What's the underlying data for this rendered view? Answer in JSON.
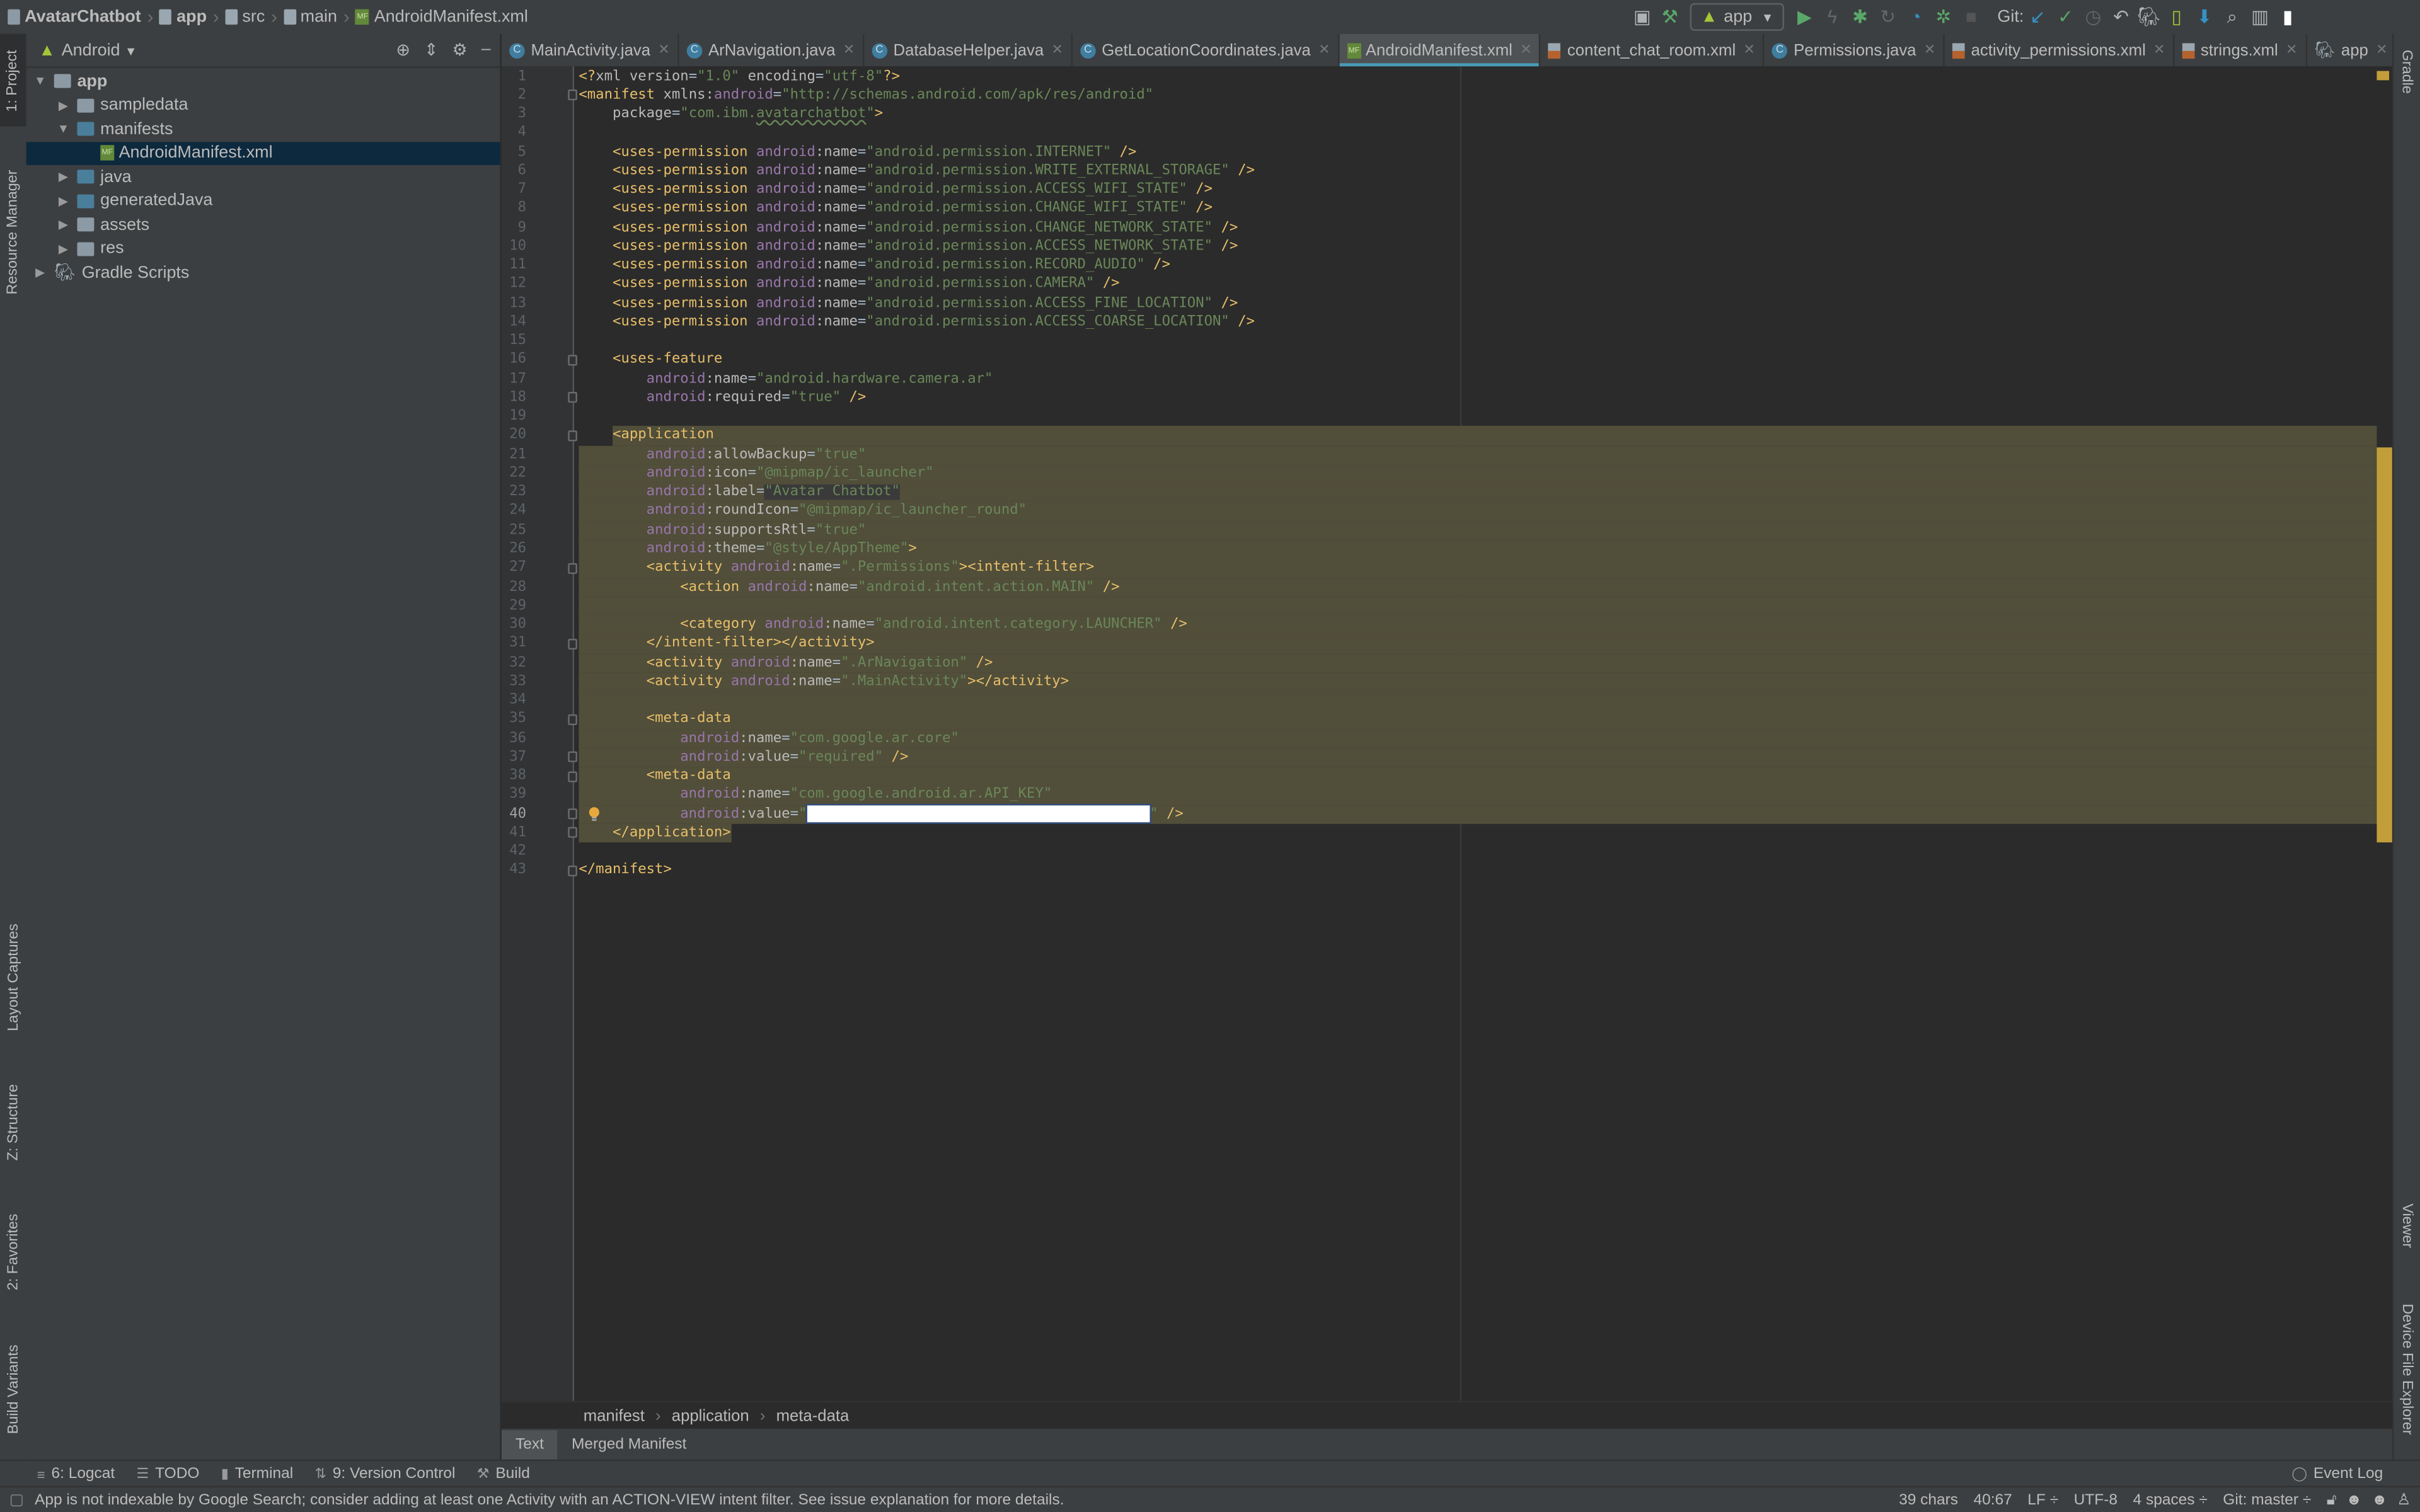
{
  "breadcrumb": [
    "AvatarChatbot",
    "app",
    "src",
    "main",
    "AndroidManifest.xml"
  ],
  "toolbar": {
    "run_config": "app",
    "git_label": "Git:",
    "icons": [
      "terminal-icon",
      "hammer-icon",
      "run-icon",
      "apply-changes-icon",
      "debug-icon",
      "attach-debugger-icon",
      "profile-icon",
      "coverage-icon",
      "stop-icon",
      "git-update-icon",
      "git-commit-icon",
      "git-history-icon",
      "git-rollback-icon",
      "gradle-sync-icon",
      "avd-manager-icon",
      "sdk-manager-icon",
      "search-icon",
      "project-structure-icon",
      "user-icon"
    ]
  },
  "left_strip": [
    "1: Project",
    "Resource Manager",
    "Layout Captures",
    "Z: Structure",
    "2: Favorites",
    "Build Variants"
  ],
  "right_strip": [
    "Gradle",
    "Viewer",
    "Device File Explorer"
  ],
  "project_panel": {
    "view": "Android",
    "tree": [
      {
        "label": "app",
        "depth": 0,
        "expanded": true,
        "icon": "module-folder"
      },
      {
        "label": "sampledata",
        "depth": 1,
        "expanded": false,
        "icon": "folder"
      },
      {
        "label": "manifests",
        "depth": 1,
        "expanded": true,
        "icon": "source-folder"
      },
      {
        "label": "AndroidManifest.xml",
        "depth": 2,
        "icon": "manifest-file",
        "selected": true
      },
      {
        "label": "java",
        "depth": 1,
        "expanded": false,
        "icon": "source-folder"
      },
      {
        "label": "generatedJava",
        "depth": 1,
        "expanded": false,
        "icon": "generated-folder"
      },
      {
        "label": "assets",
        "depth": 1,
        "expanded": false,
        "icon": "resource-folder"
      },
      {
        "label": "res",
        "depth": 1,
        "expanded": false,
        "icon": "resource-folder"
      },
      {
        "label": "Gradle Scripts",
        "depth": 0,
        "expanded": false,
        "icon": "gradle"
      }
    ]
  },
  "tabs": [
    {
      "label": "MainActivity.java",
      "icon": "java-class"
    },
    {
      "label": "ArNavigation.java",
      "icon": "java-class"
    },
    {
      "label": "DatabaseHelper.java",
      "icon": "java-class"
    },
    {
      "label": "GetLocationCoordinates.java",
      "icon": "java-class"
    },
    {
      "label": "AndroidManifest.xml",
      "icon": "manifest",
      "active": true
    },
    {
      "label": "content_chat_room.xml",
      "icon": "xml"
    },
    {
      "label": "Permissions.java",
      "icon": "java-class"
    },
    {
      "label": "activity_permissions.xml",
      "icon": "xml"
    },
    {
      "label": "strings.xml",
      "icon": "xml"
    },
    {
      "label": "app",
      "icon": "gradle"
    }
  ],
  "editor": {
    "caret_line": 40,
    "selection": {
      "from_line": 20,
      "to_line": 41
    },
    "fold_lines": [
      2,
      16,
      18,
      20,
      27,
      31,
      35,
      37,
      38,
      40,
      41,
      43
    ],
    "lines": [
      [
        [
          "t",
          "<?"
        ],
        [
          "a",
          "xml version"
        ],
        [
          "p",
          "="
        ],
        [
          "s",
          "\"1.0\""
        ],
        [
          "a",
          " encoding"
        ],
        [
          "p",
          "="
        ],
        [
          "s",
          "\"utf-8\""
        ],
        [
          "t",
          "?>"
        ]
      ],
      [
        [
          "t",
          "<manifest"
        ],
        [
          "a",
          " xmlns:"
        ],
        [
          "n",
          "android"
        ],
        [
          "p",
          "="
        ],
        [
          "s",
          "\"http://schemas.android.com/apk/res/android\""
        ]
      ],
      [
        [
          "w",
          "    "
        ],
        [
          "a",
          "package"
        ],
        [
          "p",
          "="
        ],
        [
          "s",
          "\"com.ibm."
        ],
        [
          "u",
          "avatarchatbot"
        ],
        [
          "s",
          "\""
        ],
        [
          "t",
          ">"
        ]
      ],
      [],
      [
        [
          "w",
          "    "
        ],
        [
          "t",
          "<uses-permission "
        ],
        [
          "n",
          "android"
        ],
        [
          "a",
          ":name"
        ],
        [
          "p",
          "="
        ],
        [
          "s",
          "\"android.permission.INTERNET\""
        ],
        [
          "t",
          " />"
        ]
      ],
      [
        [
          "w",
          "    "
        ],
        [
          "t",
          "<uses-permission "
        ],
        [
          "n",
          "android"
        ],
        [
          "a",
          ":name"
        ],
        [
          "p",
          "="
        ],
        [
          "s",
          "\"android.permission.WRITE_EXTERNAL_STORAGE\""
        ],
        [
          "t",
          " />"
        ]
      ],
      [
        [
          "w",
          "    "
        ],
        [
          "t",
          "<uses-permission "
        ],
        [
          "n",
          "android"
        ],
        [
          "a",
          ":name"
        ],
        [
          "p",
          "="
        ],
        [
          "s",
          "\"android.permission.ACCESS_WIFI_STATE\""
        ],
        [
          "t",
          " />"
        ]
      ],
      [
        [
          "w",
          "    "
        ],
        [
          "t",
          "<uses-permission "
        ],
        [
          "n",
          "android"
        ],
        [
          "a",
          ":name"
        ],
        [
          "p",
          "="
        ],
        [
          "s",
          "\"android.permission.CHANGE_WIFI_STATE\""
        ],
        [
          "t",
          " />"
        ]
      ],
      [
        [
          "w",
          "    "
        ],
        [
          "t",
          "<uses-permission "
        ],
        [
          "n",
          "android"
        ],
        [
          "a",
          ":name"
        ],
        [
          "p",
          "="
        ],
        [
          "s",
          "\"android.permission.CHANGE_NETWORK_STATE\""
        ],
        [
          "t",
          " />"
        ]
      ],
      [
        [
          "w",
          "    "
        ],
        [
          "t",
          "<uses-permission "
        ],
        [
          "n",
          "android"
        ],
        [
          "a",
          ":name"
        ],
        [
          "p",
          "="
        ],
        [
          "s",
          "\"android.permission.ACCESS_NETWORK_STATE\""
        ],
        [
          "t",
          " />"
        ]
      ],
      [
        [
          "w",
          "    "
        ],
        [
          "t",
          "<uses-permission "
        ],
        [
          "n",
          "android"
        ],
        [
          "a",
          ":name"
        ],
        [
          "p",
          "="
        ],
        [
          "s",
          "\"android.permission.RECORD_AUDIO\""
        ],
        [
          "t",
          " />"
        ]
      ],
      [
        [
          "w",
          "    "
        ],
        [
          "t",
          "<uses-permission "
        ],
        [
          "n",
          "android"
        ],
        [
          "a",
          ":name"
        ],
        [
          "p",
          "="
        ],
        [
          "s",
          "\"android.permission.CAMERA\""
        ],
        [
          "t",
          " />"
        ]
      ],
      [
        [
          "w",
          "    "
        ],
        [
          "t",
          "<uses-permission "
        ],
        [
          "n",
          "android"
        ],
        [
          "a",
          ":name"
        ],
        [
          "p",
          "="
        ],
        [
          "s",
          "\"android.permission.ACCESS_FINE_LOCATION\""
        ],
        [
          "t",
          " />"
        ]
      ],
      [
        [
          "w",
          "    "
        ],
        [
          "t",
          "<uses-permission "
        ],
        [
          "n",
          "android"
        ],
        [
          "a",
          ":name"
        ],
        [
          "p",
          "="
        ],
        [
          "s",
          "\"android.permission.ACCESS_COARSE_LOCATION\""
        ],
        [
          "t",
          " />"
        ]
      ],
      [],
      [
        [
          "w",
          "    "
        ],
        [
          "t",
          "<uses-feature"
        ]
      ],
      [
        [
          "w",
          "        "
        ],
        [
          "n",
          "android"
        ],
        [
          "a",
          ":name"
        ],
        [
          "p",
          "="
        ],
        [
          "s",
          "\"android.hardware.camera.ar\""
        ]
      ],
      [
        [
          "w",
          "        "
        ],
        [
          "n",
          "android"
        ],
        [
          "a",
          ":required"
        ],
        [
          "p",
          "="
        ],
        [
          "s",
          "\"true\""
        ],
        [
          "t",
          " />"
        ]
      ],
      [],
      [
        [
          "w",
          "    "
        ],
        [
          "t",
          "<application"
        ]
      ],
      [
        [
          "w",
          "        "
        ],
        [
          "n",
          "android"
        ],
        [
          "a",
          ":allowBackup"
        ],
        [
          "p",
          "="
        ],
        [
          "s",
          "\"true\""
        ]
      ],
      [
        [
          "w",
          "        "
        ],
        [
          "n",
          "android"
        ],
        [
          "a",
          ":icon"
        ],
        [
          "p",
          "="
        ],
        [
          "s",
          "\"@mipmap/ic_launcher\""
        ]
      ],
      [
        [
          "w",
          "        "
        ],
        [
          "n",
          "android"
        ],
        [
          "a",
          ":label"
        ],
        [
          "p",
          "="
        ],
        [
          "sel",
          "\"Avatar Chatbot\""
        ]
      ],
      [
        [
          "w",
          "        "
        ],
        [
          "n",
          "android"
        ],
        [
          "a",
          ":roundIcon"
        ],
        [
          "p",
          "="
        ],
        [
          "s",
          "\"@mipmap/ic_launcher_round\""
        ]
      ],
      [
        [
          "w",
          "        "
        ],
        [
          "n",
          "android"
        ],
        [
          "a",
          ":supportsRtl"
        ],
        [
          "p",
          "="
        ],
        [
          "s",
          "\"true\""
        ]
      ],
      [
        [
          "w",
          "        "
        ],
        [
          "n",
          "android"
        ],
        [
          "a",
          ":theme"
        ],
        [
          "p",
          "="
        ],
        [
          "s",
          "\"@style/AppTheme\""
        ],
        [
          "t",
          ">"
        ]
      ],
      [
        [
          "w",
          "        "
        ],
        [
          "t",
          "<activity "
        ],
        [
          "n",
          "android"
        ],
        [
          "a",
          ":name"
        ],
        [
          "p",
          "="
        ],
        [
          "s",
          "\".Permissions\""
        ],
        [
          "t",
          "><intent-filter>"
        ]
      ],
      [
        [
          "w",
          "            "
        ],
        [
          "t",
          "<action "
        ],
        [
          "n",
          "android"
        ],
        [
          "a",
          ":name"
        ],
        [
          "p",
          "="
        ],
        [
          "s",
          "\"android.intent.action.MAIN\""
        ],
        [
          "t",
          " />"
        ]
      ],
      [],
      [
        [
          "w",
          "            "
        ],
        [
          "t",
          "<category "
        ],
        [
          "n",
          "android"
        ],
        [
          "a",
          ":name"
        ],
        [
          "p",
          "="
        ],
        [
          "s",
          "\"android.intent.category.LAUNCHER\""
        ],
        [
          "t",
          " />"
        ]
      ],
      [
        [
          "w",
          "        "
        ],
        [
          "t",
          "</intent-filter></activity>"
        ]
      ],
      [
        [
          "w",
          "        "
        ],
        [
          "t",
          "<activity "
        ],
        [
          "n",
          "android"
        ],
        [
          "a",
          ":name"
        ],
        [
          "p",
          "="
        ],
        [
          "s",
          "\".ArNavigation\""
        ],
        [
          "t",
          " />"
        ]
      ],
      [
        [
          "w",
          "        "
        ],
        [
          "t",
          "<activity "
        ],
        [
          "n",
          "android"
        ],
        [
          "a",
          ":name"
        ],
        [
          "p",
          "="
        ],
        [
          "s",
          "\".MainActivity\""
        ],
        [
          "t",
          "></activity>"
        ]
      ],
      [],
      [
        [
          "w",
          "        "
        ],
        [
          "t",
          "<meta-data"
        ]
      ],
      [
        [
          "w",
          "            "
        ],
        [
          "n",
          "android"
        ],
        [
          "a",
          ":name"
        ],
        [
          "p",
          "="
        ],
        [
          "s",
          "\"com.google.ar.core\""
        ]
      ],
      [
        [
          "w",
          "            "
        ],
        [
          "n",
          "android"
        ],
        [
          "a",
          ":value"
        ],
        [
          "p",
          "="
        ],
        [
          "s",
          "\"required\""
        ],
        [
          "t",
          " />"
        ]
      ],
      [
        [
          "w",
          "        "
        ],
        [
          "t",
          "<meta-data"
        ]
      ],
      [
        [
          "w",
          "            "
        ],
        [
          "n",
          "android"
        ],
        [
          "a",
          ":name"
        ],
        [
          "p",
          "="
        ],
        [
          "s",
          "\"com.google.android.ar.API_KEY\""
        ]
      ],
      [
        [
          "w",
          "            "
        ],
        [
          "n",
          "android"
        ],
        [
          "a",
          ":value"
        ],
        [
          "p",
          "="
        ],
        [
          "s",
          "\""
        ],
        [
          "r",
          ""
        ],
        [
          "s",
          "\""
        ],
        [
          "t",
          " />"
        ]
      ],
      [
        [
          "w",
          "    "
        ],
        [
          "t",
          "</application>"
        ]
      ],
      [],
      [
        [
          "t",
          "</manifest>"
        ]
      ]
    ]
  },
  "editor_breadcrumb": [
    "manifest",
    "application",
    "meta-data"
  ],
  "editor_tabs": [
    {
      "label": "Text",
      "active": true
    },
    {
      "label": "Merged Manifest"
    }
  ],
  "tool_windows": [
    {
      "label": "6: Logcat",
      "icon": "logcat-icon"
    },
    {
      "label": "TODO",
      "icon": "todo-icon"
    },
    {
      "label": "Terminal",
      "icon": "terminal-icon"
    },
    {
      "label": "9: Version Control",
      "icon": "version-control-icon"
    },
    {
      "label": "Build",
      "icon": "build-icon"
    }
  ],
  "event_log": "Event Log",
  "status": {
    "message": "App is not indexable by Google Search; consider adding at least one Activity with an ACTION-VIEW intent filter. See issue explanation for more details.",
    "chars": "39 chars",
    "position": "40:67",
    "line_sep": "LF ÷",
    "encoding": "UTF-8",
    "indent": "4 spaces ÷",
    "git": "Git: master ÷"
  },
  "colors": {
    "tag": "#e8bf6a",
    "ns": "#9876aa",
    "string": "#6a8759",
    "attr": "#bababa",
    "selection": "#514e3a",
    "active_tab_underline": "#4a9bb8"
  }
}
